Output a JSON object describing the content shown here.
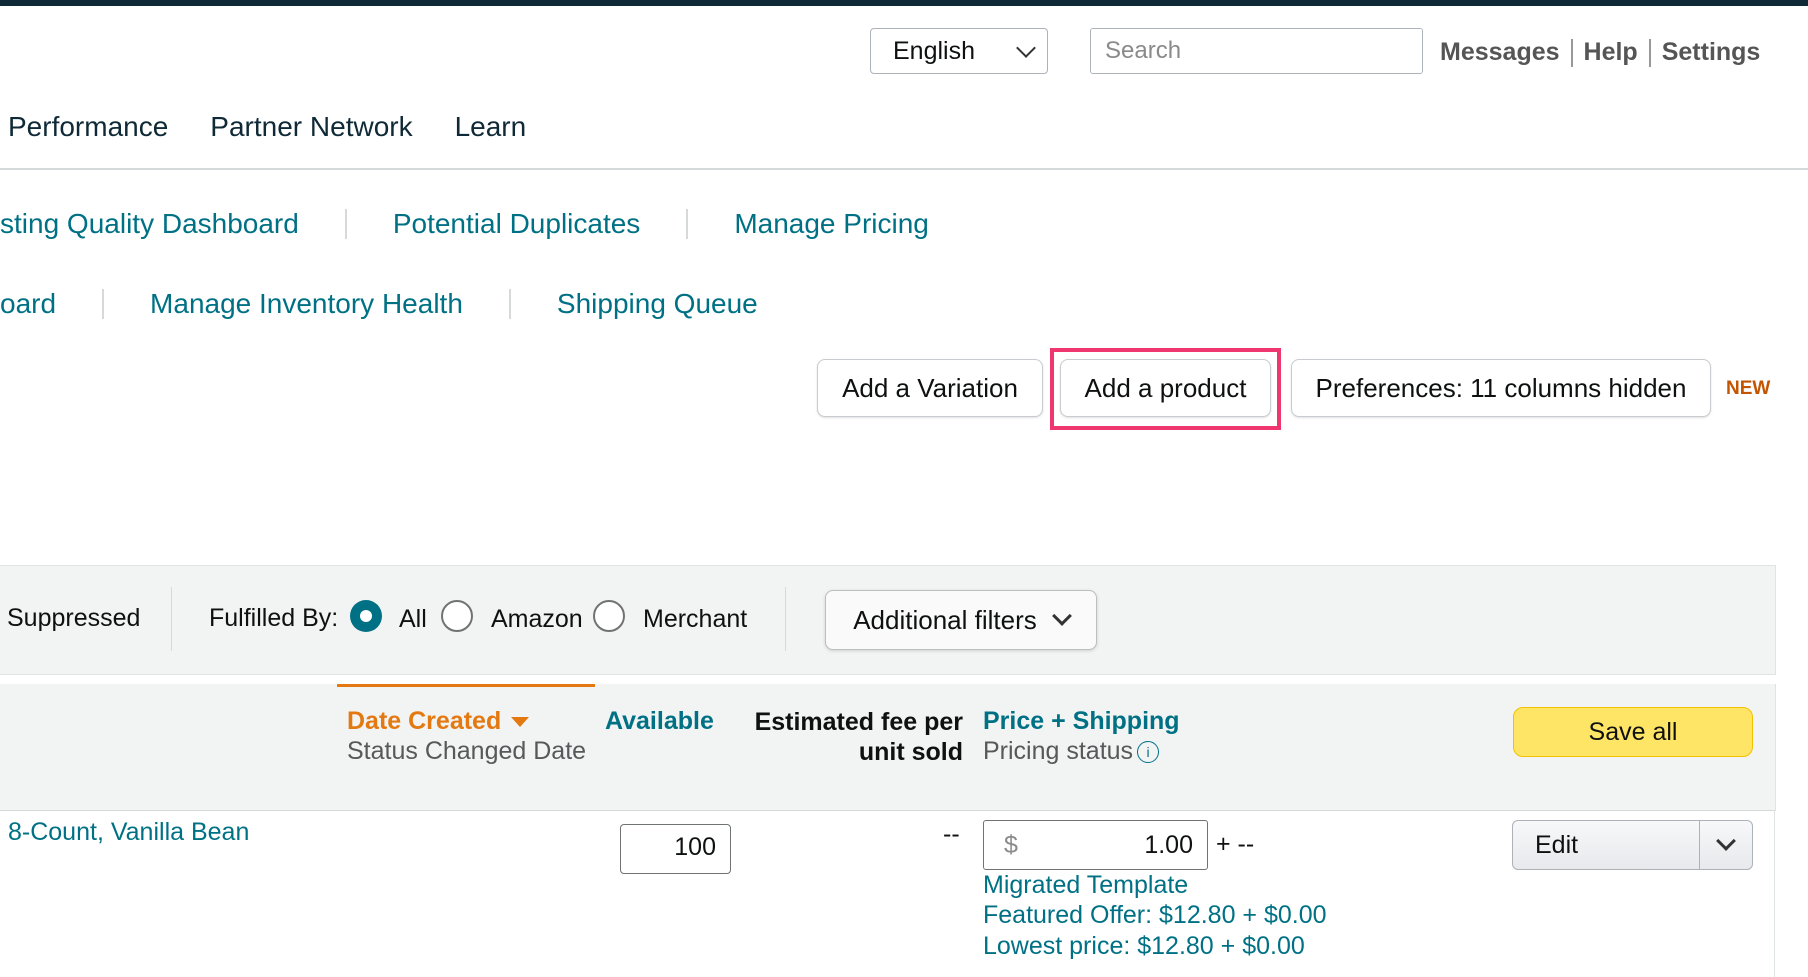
{
  "header": {
    "language": "English",
    "search_placeholder": "Search",
    "links": [
      "Messages",
      "Help",
      "Settings"
    ]
  },
  "main_nav": [
    "Performance",
    "Partner Network",
    "Learn"
  ],
  "sub_links_row1": [
    "sting Quality Dashboard",
    "Potential Duplicates",
    "Manage Pricing"
  ],
  "sub_links_row2": [
    "oard",
    "Manage Inventory Health",
    "Shipping Queue"
  ],
  "actions": {
    "add_variation": "Add a Variation",
    "add_product": "Add a product",
    "preferences": "Preferences: 11 columns hidden",
    "new_badge": "NEW"
  },
  "filters": {
    "suppressed": "Suppressed",
    "fulfilled_by_label": "Fulfilled By:",
    "options": [
      "All",
      "Amazon",
      "Merchant"
    ],
    "selected": "All",
    "additional_filters": "Additional filters"
  },
  "table_header": {
    "date_created": "Date Created",
    "status_changed_date": "Status Changed Date",
    "available": "Available",
    "estimated_fee_line1": "Estimated fee per",
    "estimated_fee_line2": "unit sold",
    "price_shipping": "Price + Shipping",
    "pricing_status": "Pricing status",
    "save_all": "Save all"
  },
  "row": {
    "product_name": "8-Count, Vanilla Bean",
    "available_qty": "100",
    "estimated_fee": "--",
    "currency": "$",
    "price": "1.00",
    "shipping": "+ --",
    "migrated_template": "Migrated Template",
    "featured_offer": "Featured Offer: $12.80 + $0.00",
    "lowest_price": "Lowest price: $12.80 + $0.00",
    "edit": "Edit"
  }
}
